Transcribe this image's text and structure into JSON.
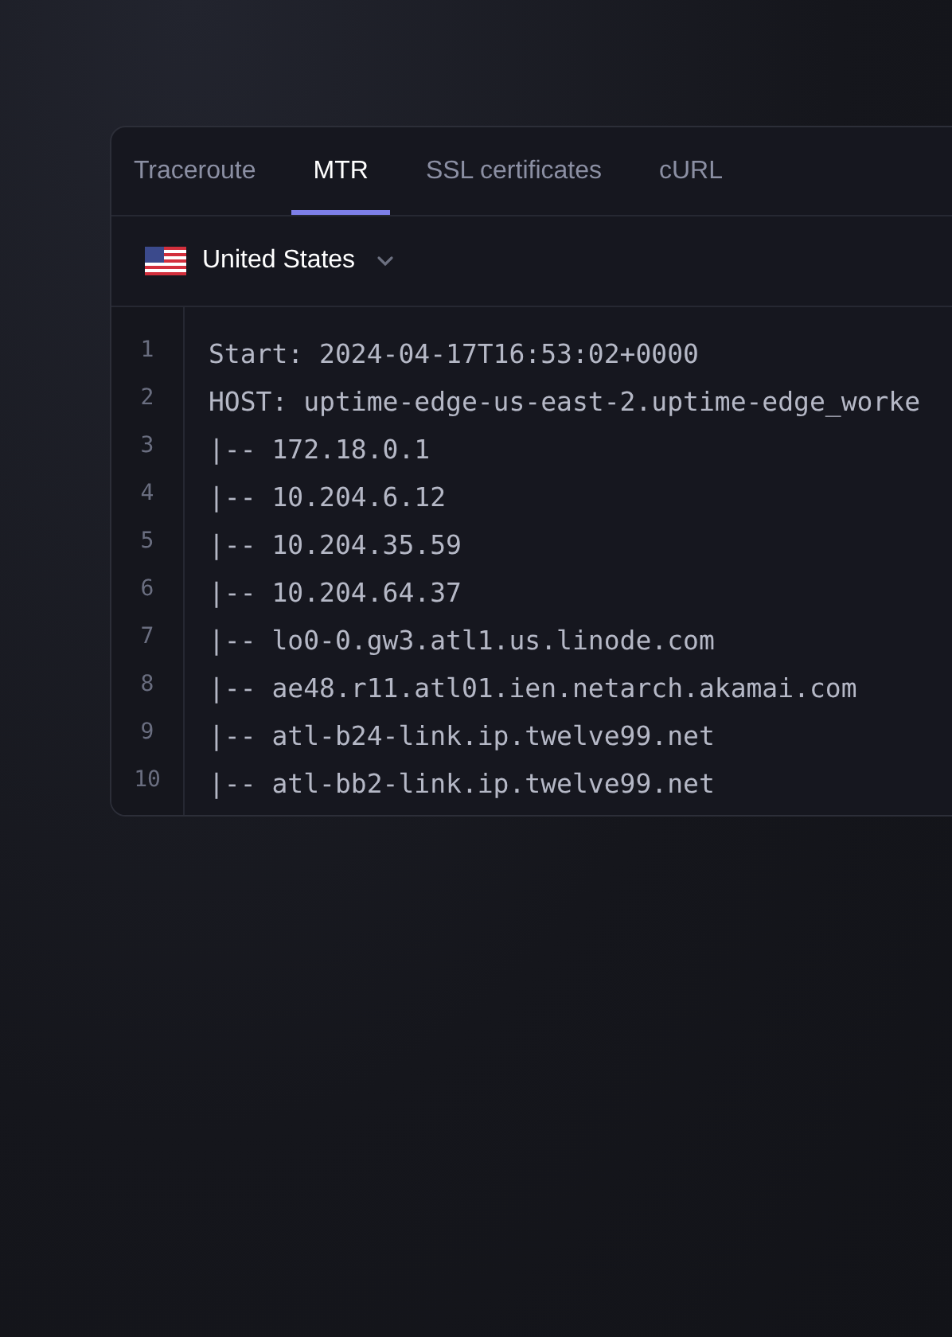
{
  "tabs": [
    {
      "label": "Traceroute",
      "selected": false
    },
    {
      "label": "MTR",
      "selected": true
    },
    {
      "label": "SSL certificates",
      "selected": false
    },
    {
      "label": "cURL",
      "selected": false
    }
  ],
  "location": {
    "label": "United States"
  },
  "code_lines": [
    {
      "number": "1",
      "text": "Start: 2024-04-17T16:53:02+0000"
    },
    {
      "number": "2",
      "text": "HOST: uptime-edge-us-east-2.uptime-edge_worke"
    },
    {
      "number": "3",
      "text": "|-- 172.18.0.1"
    },
    {
      "number": "4",
      "text": "|-- 10.204.6.12"
    },
    {
      "number": "5",
      "text": "|-- 10.204.35.59"
    },
    {
      "number": "6",
      "text": "|-- 10.204.64.37"
    },
    {
      "number": "7",
      "text": "|-- lo0-0.gw3.atl1.us.linode.com"
    },
    {
      "number": "8",
      "text": "|-- ae48.r11.atl01.ien.netarch.akamai.com"
    },
    {
      "number": "9",
      "text": "|-- atl-b24-link.ip.twelve99.net"
    },
    {
      "number": "10",
      "text": "|-- atl-bb2-link.ip.twelve99.net"
    }
  ]
}
